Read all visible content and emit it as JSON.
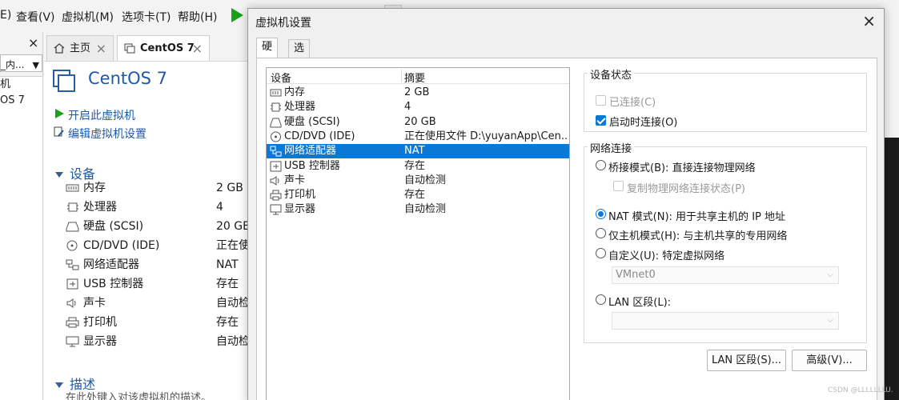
{
  "menubar": {
    "items": [
      {
        "label": "E)"
      },
      {
        "label": "查看(V)"
      },
      {
        "label": "虚拟机(M)"
      },
      {
        "label": "选项卡(T)"
      },
      {
        "label": "帮助(H)"
      }
    ]
  },
  "left_pane": {
    "close": "×",
    "combo_value": "_内...",
    "tree": [
      "机",
      "OS 7"
    ]
  },
  "tabs": [
    {
      "label": "主页",
      "close": "×"
    },
    {
      "label": "CentOS 7",
      "close": "×"
    }
  ],
  "vm": {
    "title": "CentOS 7",
    "actions": [
      "开启此虚拟机",
      "编辑虚拟机设置"
    ],
    "devices_heading": "设备",
    "devices": [
      {
        "name": "内存",
        "value": "2 GB"
      },
      {
        "name": "处理器",
        "value": "4"
      },
      {
        "name": "硬盘 (SCSI)",
        "value": "20 GB"
      },
      {
        "name": "CD/DVD (IDE)",
        "value": "正在使用"
      },
      {
        "name": "网络适配器",
        "value": "NAT"
      },
      {
        "name": "USB 控制器",
        "value": "存在"
      },
      {
        "name": "声卡",
        "value": "自动检"
      },
      {
        "name": "打印机",
        "value": "存在"
      },
      {
        "name": "显示器",
        "value": "自动检"
      }
    ],
    "description_heading": "描述",
    "description_hint": "在此处键入对该虚拟机的描述。"
  },
  "dialog": {
    "title": "虚拟机设置",
    "close": "×",
    "tabs": [
      "硬件",
      "选项"
    ],
    "table": {
      "headers": [
        "设备",
        "摘要"
      ],
      "rows": [
        {
          "name": "内存",
          "summary": "2 GB",
          "icon": "memory-icon"
        },
        {
          "name": "处理器",
          "summary": "4",
          "icon": "cpu-icon"
        },
        {
          "name": "硬盘 (SCSI)",
          "summary": "20 GB",
          "icon": "disk-icon"
        },
        {
          "name": "CD/DVD (IDE)",
          "summary": "正在使用文件 D:\\yuyanApp\\Cen...",
          "icon": "cd-icon"
        },
        {
          "name": "网络适配器",
          "summary": "NAT",
          "icon": "network-icon",
          "selected": true
        },
        {
          "name": "USB 控制器",
          "summary": "存在",
          "icon": "usb-icon"
        },
        {
          "name": "声卡",
          "summary": "自动检测",
          "icon": "sound-icon"
        },
        {
          "name": "打印机",
          "summary": "存在",
          "icon": "printer-icon"
        },
        {
          "name": "显示器",
          "summary": "自动检测",
          "icon": "monitor-icon"
        }
      ]
    },
    "device_status": {
      "title": "设备状态",
      "connected": {
        "label": "已连接(C)",
        "checked": false,
        "disabled": true
      },
      "connect_at_power_on": {
        "label": "启动时连接(O)",
        "checked": true
      }
    },
    "network": {
      "title": "网络连接",
      "bridged": "桥接模式(B): 直接连接物理网络",
      "replicate": "复制物理网络连接状态(P)",
      "nat": "NAT 模式(N): 用于共享主机的 IP 地址",
      "host_only": "仅主机模式(H): 与主机共享的专用网络",
      "custom": "自定义(U): 特定虚拟网络",
      "custom_value": "VMnet0",
      "lan": "LAN 区段(L):",
      "lan_value": "",
      "selected": "nat"
    },
    "buttons": {
      "lan_segments": "LAN 区段(S)...",
      "advanced": "高级(V)..."
    }
  },
  "watermark": "CSDN @LLLLLLLU.",
  "colors": {
    "accent": "#0a78d7",
    "link": "#1e5aa8",
    "play": "#18a218"
  }
}
